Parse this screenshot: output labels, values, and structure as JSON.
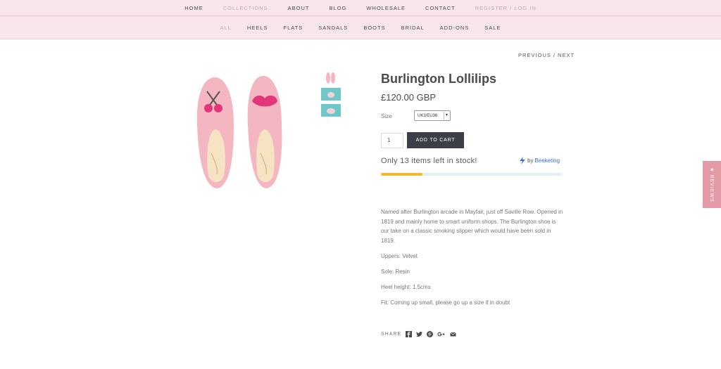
{
  "topnav": {
    "items": [
      "HOME",
      "COLLECTIONS",
      "ABOUT",
      "BLOG",
      "WHOLESALE",
      "CONTACT",
      "REGISTER / LOG IN"
    ]
  },
  "subnav": {
    "items": [
      "ALL",
      "HEELS",
      "FLATS",
      "SANDALS",
      "BOOTS",
      "BRIDAL",
      "ADD-ONS",
      "SALE"
    ]
  },
  "pager": {
    "previous": "PREVIOUS",
    "separator": " / ",
    "next": "NEXT"
  },
  "product": {
    "title": "Burlington Lollilips",
    "price": "£120.00 GBP",
    "size_label": "Size",
    "size_value": "UK3/EU36",
    "quantity": "1",
    "add_to_cart": "ADD TO CART",
    "stock_text": "Only 13 items left in stock!",
    "stock_fraction": 0.23,
    "description": [
      "Named after Burlington arcade in Mayfair, just off Saville Row. Opened in 1819 and mainly home to smart uniform shops. The Burlington shoe is our take on a classic smoking slipper which would have been sold in 1819.",
      "Uppers: Velvet",
      "Sole: Resin",
      "Heel height: 1.5cms",
      "Fit: Coming up small, please go up a size if in doubt"
    ]
  },
  "beeketing": {
    "by": "by",
    "brand": "Beeketing"
  },
  "share": {
    "label": "SHARE",
    "icons": [
      "facebook-icon",
      "twitter-icon",
      "pinterest-icon",
      "google-plus-icon",
      "email-icon"
    ]
  },
  "reviews_tab": {
    "label": "★ REVIEWS"
  },
  "colors": {
    "nav_bg": "#f9e6ea",
    "button_bg": "#3c3f45",
    "stock_fill": "#f0b82d",
    "reviews_tab": "#e29aa6",
    "beeketing_link": "#3a6fd8"
  }
}
